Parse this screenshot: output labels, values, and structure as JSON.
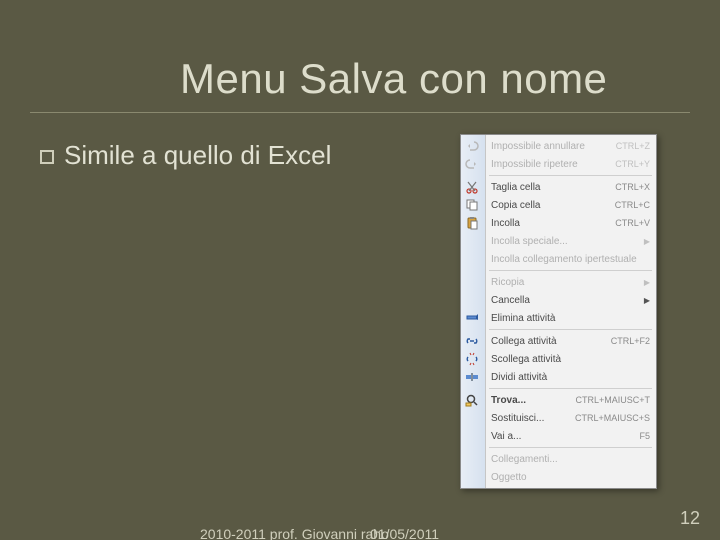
{
  "slide": {
    "title": "Menu Salva con nome",
    "body_text": "Simile a quello di Excel",
    "footer_author": "2010-2011 prof. Giovanni raho",
    "footer_date": "01/05/2011",
    "page_number": "12"
  },
  "menu": {
    "items": [
      {
        "icon": "undo",
        "label": "Impossibile annullare",
        "shortcut": "CTRL+Z",
        "disabled": true
      },
      {
        "icon": "redo",
        "label": "Impossibile ripetere",
        "shortcut": "CTRL+Y",
        "disabled": true
      },
      {
        "sep": true
      },
      {
        "icon": "cut",
        "label": "Taglia cella",
        "shortcut": "CTRL+X"
      },
      {
        "icon": "copy",
        "label": "Copia cella",
        "shortcut": "CTRL+C"
      },
      {
        "icon": "paste",
        "label": "Incolla",
        "shortcut": "CTRL+V"
      },
      {
        "icon": "",
        "label": "Incolla speciale...",
        "submenu": true,
        "disabled": true
      },
      {
        "icon": "",
        "label": "Incolla collegamento ipertestuale",
        "disabled": true
      },
      {
        "sep": true
      },
      {
        "icon": "",
        "label": "Ricopia",
        "submenu": true,
        "disabled": true
      },
      {
        "icon": "",
        "label": "Cancella",
        "submenu": true
      },
      {
        "icon": "delete",
        "label": "Elimina attività"
      },
      {
        "sep": true
      },
      {
        "icon": "link",
        "label": "Collega attività",
        "shortcut": "CTRL+F2"
      },
      {
        "icon": "unlink",
        "label": "Scollega attività"
      },
      {
        "icon": "split",
        "label": "Dividi attività"
      },
      {
        "sep": true
      },
      {
        "icon": "find",
        "label": "Trova...",
        "shortcut": "CTRL+MAIUSC+T",
        "strong": true
      },
      {
        "icon": "",
        "label": "Sostituisci...",
        "shortcut": "CTRL+MAIUSC+S"
      },
      {
        "icon": "",
        "label": "Vai a...",
        "shortcut": "F5"
      },
      {
        "sep": true
      },
      {
        "icon": "",
        "label": "Collegamenti...",
        "disabled": true
      },
      {
        "icon": "",
        "label": "Oggetto",
        "disabled": true
      }
    ]
  }
}
